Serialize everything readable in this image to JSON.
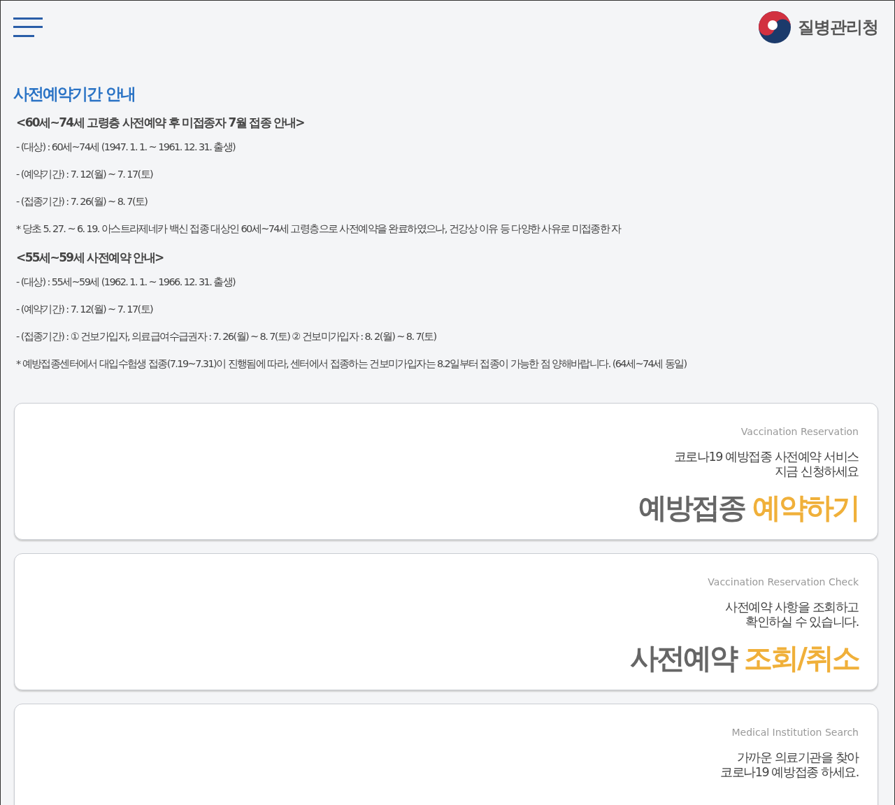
{
  "header": {
    "logo_text": "질병관리청"
  },
  "notice": {
    "title": "사전예약기간 안내",
    "sections": [
      {
        "heading": "<60세~74세 고령층 사전예약 후 미접종자 7월 접종 안내>",
        "lines": [
          "- (대상) : 60세~74세 (1947. 1. 1. ~ 1961. 12. 31. 출생)",
          "- (예약기간) : 7. 12(월) ~ 7. 17(토)",
          "- (접종기간) : 7. 26(월) ~ 8. 7(토)",
          "* 당초 5. 27. ~ 6. 19. 아스트라제네카 백신 접종 대상인 60세~74세 고령층으로 사전예약을 완료하였으나, 건강상 이유 등 다양한 사유로 미접종한 자"
        ]
      },
      {
        "heading": "<55세~59세 사전예약 안내>",
        "lines": [
          "- (대상) : 55세~59세 (1962. 1. 1. ~ 1966. 12. 31. 출생)",
          "- (예약기간) : 7. 12(월) ~ 7. 17(토)",
          "- (접종기간) : ① 건보가입자, 의료급여수급권자 : 7. 26(월) ~ 8. 7(토) ② 건보미가입자 : 8. 2(월) ~ 8. 7(토)",
          "* 예방접종센터에서 대입수험생 접종(7.19~7.31)이 진행됨에 따라, 센터에서 접종하는 건보미가입자는 8.2일부터 접종이 가능한 점 양해바랍니다. (64세~74세 동일)"
        ]
      }
    ]
  },
  "cards": [
    {
      "subtitle": "Vaccination Reservation",
      "description": [
        "코로나19 예방접종 사전예약 서비스",
        "지금 신청하세요"
      ],
      "title": "예방접종",
      "highlight": "예약하기"
    },
    {
      "subtitle": "Vaccination Reservation Check",
      "description": [
        "사전예약 사항을 조회하고",
        "확인하실 수 있습니다."
      ],
      "title": "사전예약",
      "highlight": "조회/취소"
    },
    {
      "subtitle": "Medical Institution Search",
      "description": [
        "가까운 의료기관을 찾아",
        "코로나19 예방접종 하세요."
      ]
    }
  ]
}
